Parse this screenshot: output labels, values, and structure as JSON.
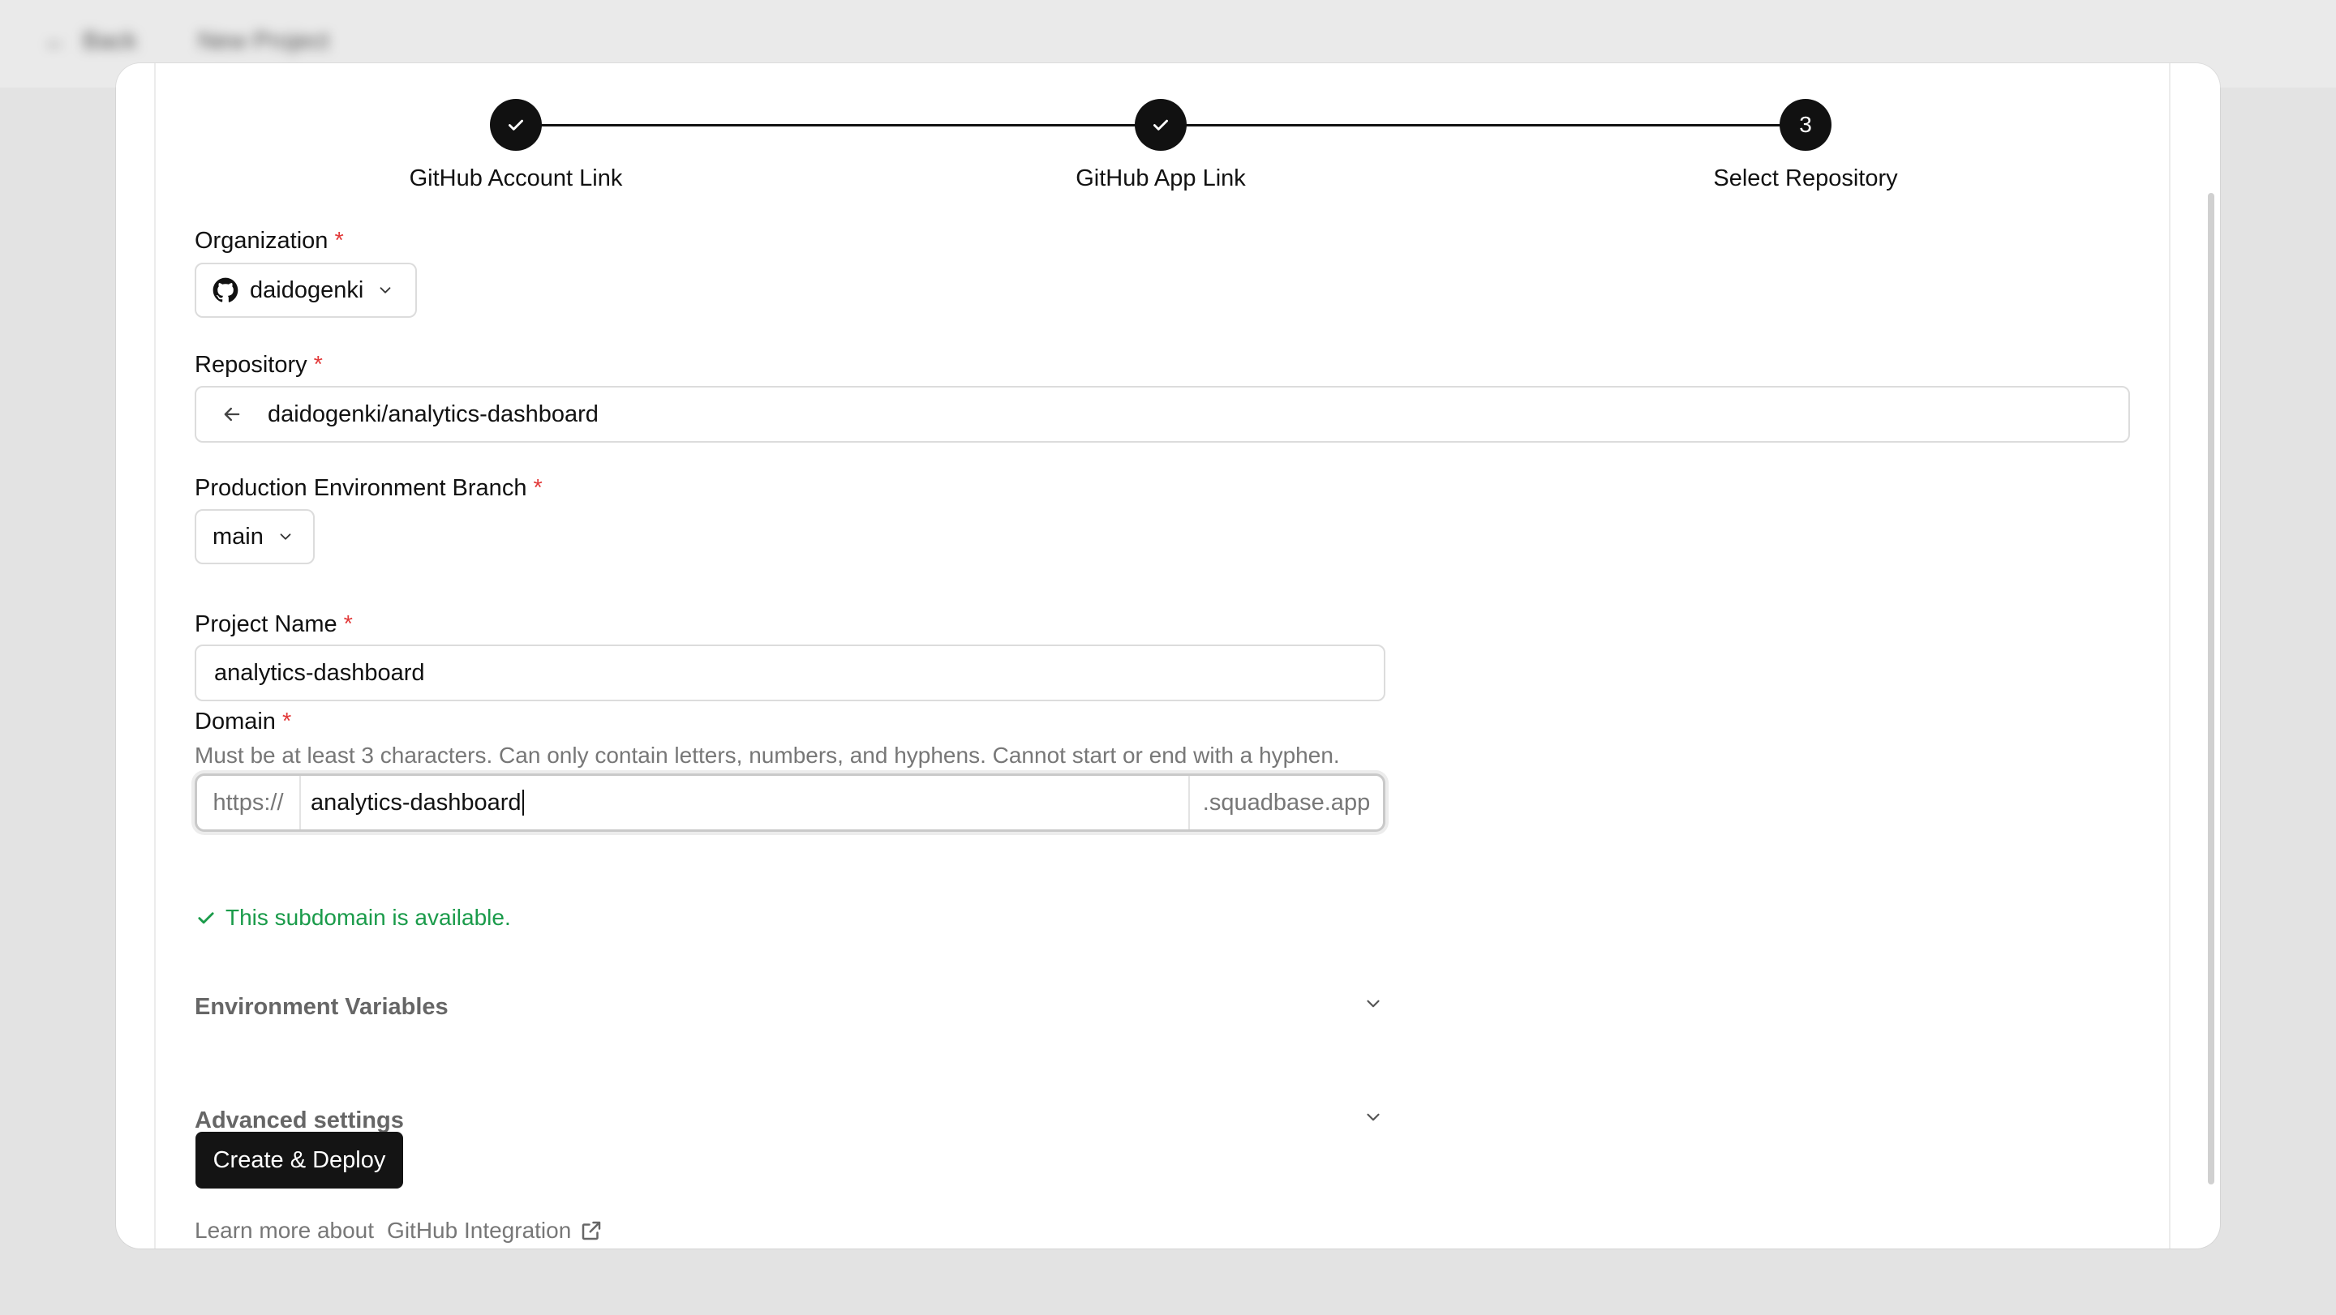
{
  "header": {
    "back_label": "Back",
    "page_title": "New Project"
  },
  "stepper": {
    "steps": [
      {
        "label": "GitHub Account Link",
        "state": "complete"
      },
      {
        "label": "GitHub App Link",
        "state": "complete"
      },
      {
        "label": "Select Repository",
        "state": "current",
        "number": "3"
      }
    ]
  },
  "form": {
    "organization": {
      "label": "Organization",
      "value": "daidogenki"
    },
    "repository": {
      "label": "Repository",
      "value": "daidogenki/analytics-dashboard"
    },
    "branch": {
      "label": "Production Environment Branch",
      "value": "main"
    },
    "project_name": {
      "label": "Project Name",
      "value": "analytics-dashboard"
    },
    "domain": {
      "label": "Domain",
      "hint": "Must be at least 3 characters. Can only contain letters, numbers, and hyphens. Cannot start or end with a hyphen.",
      "prefix": "https://",
      "value": "analytics-dashboard",
      "suffix": ".squadbase.app",
      "status": "This subdomain is available."
    },
    "required_mark": "*",
    "env_vars_label": "Environment Variables",
    "advanced_label": "Advanced settings",
    "submit_label": "Create & Deploy"
  },
  "footer": {
    "learn_more": "Learn more about",
    "link_label": "GitHub Integration"
  },
  "colors": {
    "accent": "#141414",
    "required": "#e23a3a",
    "success": "#1a9b4a"
  }
}
